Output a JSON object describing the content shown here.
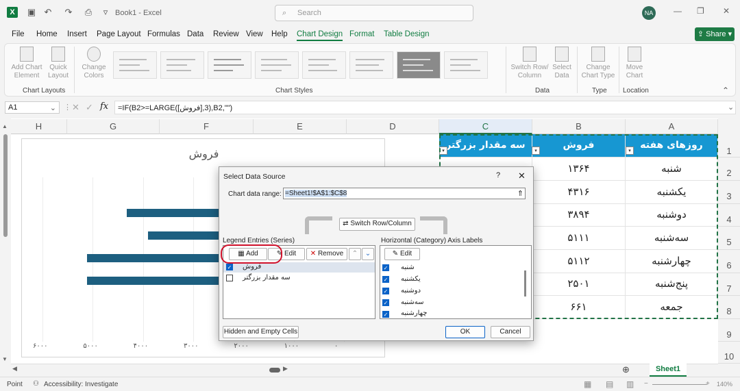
{
  "titlebar": {
    "book_title": "Book1 - Excel",
    "search_placeholder": "Search",
    "user_initials": "NA"
  },
  "menu": {
    "tabs": [
      "File",
      "Home",
      "Insert",
      "Page Layout",
      "Formulas",
      "Data",
      "Review",
      "View",
      "Help",
      "Chart Design",
      "Format",
      "Table Design"
    ],
    "active_tab": "Chart Design",
    "share_label": "Share"
  },
  "ribbon": {
    "add_chart_element": "Add Chart Element",
    "quick_layout": "Quick Layout",
    "change_colors": "Change Colors",
    "switch_row_column": "Switch Row/ Column",
    "select_data": "Select Data",
    "change_chart_type": "Change Chart Type",
    "move_chart": "Move Chart",
    "groups": {
      "chart_layouts": "Chart Layouts",
      "chart_styles": "Chart Styles",
      "data": "Data",
      "type": "Type",
      "location": "Location"
    }
  },
  "formula_bar": {
    "name_box": "A1",
    "formula": "=IF(B2>=LARGE([فروش],3),B2,\"\")"
  },
  "columns": [
    "H",
    "G",
    "F",
    "E",
    "D",
    "C",
    "B",
    "A"
  ],
  "rows": [
    "1",
    "2",
    "3",
    "4",
    "5",
    "6",
    "7",
    "8",
    "9",
    "10"
  ],
  "table": {
    "headers": {
      "a": "روزهای هفته",
      "b": "فروش",
      "c": "سه مقدار بزرگتر"
    },
    "days": [
      "شنبه",
      "یکشنبه",
      "دوشنبه",
      "سه‌شنبه",
      "چهارشنبه",
      "پنج‌شنبه",
      "جمعه"
    ],
    "sales": [
      "۱۳۶۴",
      "۴۳۱۶",
      "۳۸۹۴",
      "۵۱۱۱",
      "۵۱۱۲",
      "۲۵۰۱",
      "۶۶۱"
    ]
  },
  "chart": {
    "title": "فروش",
    "x_ticks": [
      "۶۰۰۰",
      "۵۰۰۰",
      "۴۰۰۰",
      "۳۰۰۰",
      "۲۰۰۰",
      "۱۰۰۰",
      "۰"
    ]
  },
  "chart_data": {
    "type": "bar",
    "orientation": "horizontal",
    "title": "فروش",
    "categories": [
      "شنبه",
      "یکشنبه",
      "دوشنبه",
      "سه‌شنبه",
      "چهارشنبه",
      "پنج‌شنبه",
      "جمعه"
    ],
    "values": [
      1364,
      4316,
      3894,
      5111,
      5112,
      2501,
      661
    ],
    "xlim": [
      0,
      6000
    ],
    "x_reversed": true,
    "bar_color": "#1d5f80"
  },
  "dialog": {
    "title": "Select Data Source",
    "help": "?",
    "close": "✕",
    "chart_data_range_label": "Chart data range:",
    "chart_data_range_value": "=Sheet1!$A$1:$C$8",
    "switch_button": "Switch Row/Column",
    "legend_label": "Legend Entries (Series)",
    "axis_label": "Horizontal (Category) Axis Labels",
    "add": "Add",
    "edit": "Edit",
    "remove": "Remove",
    "edit_axis": "Edit",
    "series": [
      {
        "name": "فروش",
        "checked": true
      },
      {
        "name": "سه مقدار بزرگتر",
        "checked": false
      }
    ],
    "axis_items": [
      "شنبه",
      "یکشنبه",
      "دوشنبه",
      "سه‌شنبه",
      "چهارشنبه"
    ],
    "hidden_empty": "Hidden and Empty Cells",
    "ok": "OK",
    "cancel": "Cancel"
  },
  "status": {
    "mode": "Point",
    "accessibility": "Accessibility: Investigate",
    "sheet_tab": "Sheet1",
    "zoom": "140%"
  },
  "colors": {
    "excel_green": "#107c41",
    "table_header": "#1797d2",
    "highlight_ring": "#d0112b"
  }
}
